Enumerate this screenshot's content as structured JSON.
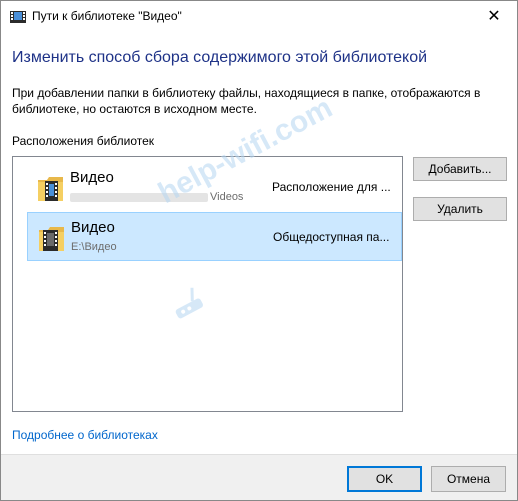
{
  "window": {
    "title": "Пути к библиотеке \"Видео\"",
    "close_symbol": "✕"
  },
  "heading": "Изменить способ сбора содержимого этой библиотекой",
  "description": "При добавлении папки в библиотеку файлы, находящиеся в папке, отображаются в библиотеке, но остаются в исходном месте.",
  "locations_label": "Расположения библиотек",
  "locations": [
    {
      "name": "Видео",
      "path_visible": "Videos",
      "status": "Расположение для ...",
      "icon": "video-folder-icon",
      "selected": false
    },
    {
      "name": "Видео",
      "path_visible": "E:\\Видео",
      "status": "Общедоступная па...",
      "icon": "public-video-folder-icon",
      "selected": true
    }
  ],
  "buttons": {
    "add": "Добавить...",
    "remove": "Удалить",
    "ok": "OK",
    "cancel": "Отмена"
  },
  "learn_more_link": "Подробнее о библиотеках",
  "watermark": "help-wifi.com",
  "colors": {
    "heading": "#1e3287",
    "link": "#0066cc",
    "selection_bg": "#cce8ff",
    "selection_border": "#99d1ff",
    "footer_bg": "#f0f0f0",
    "watermark": "#b5d6f2"
  }
}
